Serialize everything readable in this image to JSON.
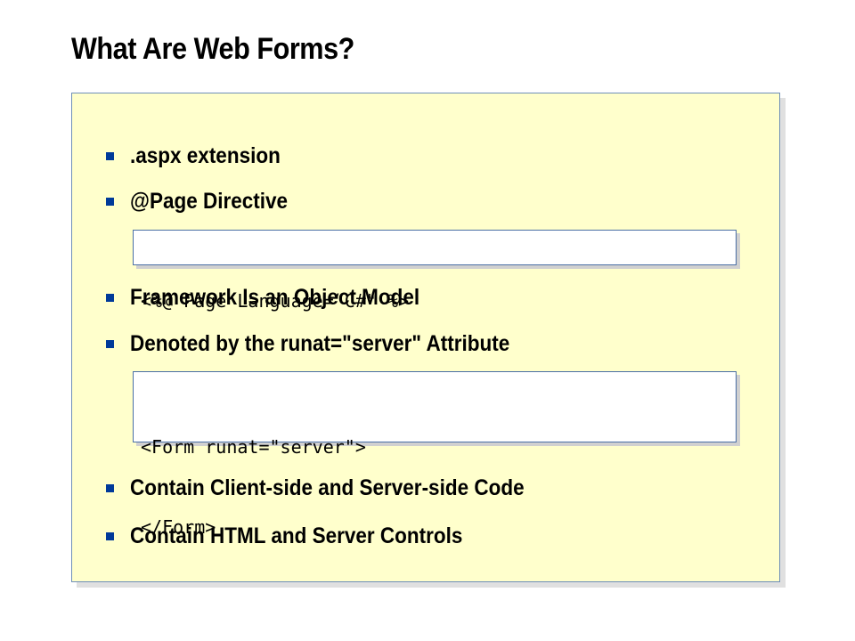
{
  "slide": {
    "title": "What Are Web Forms?"
  },
  "content": {
    "bullets_top": [
      ".aspx extension",
      "@Page Directive"
    ],
    "page_directive_code": "<%@ Page Language=“C#\" %>",
    "bullets_middle": [
      "Framework Is an Object Model",
      "Denoted by the runat=\"server\" Attribute"
    ],
    "form_code_lines": [
      "<Form runat=\"server\">",
      "</Form>"
    ],
    "bullets_bottom": [
      "Contain Client-side and Server-side Code",
      "Contain HTML and Server Controls"
    ]
  },
  "colors": {
    "panel_background": "#ffffcc",
    "panel_border": "#6e8fb8",
    "bullet": "#003a99",
    "code_box_background": "#ffffff"
  }
}
